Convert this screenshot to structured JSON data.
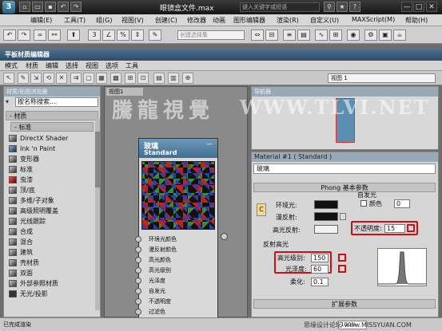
{
  "titlebar": {
    "doc_title": "眼镜盒文件.max",
    "search_placeholder": "键入关键字或短语",
    "min": "—",
    "max": "□",
    "close": "✕"
  },
  "menubar": [
    "编辑(E)",
    "工具(T)",
    "组(G)",
    "视图(V)",
    "创建(C)",
    "修改器",
    "动画",
    "图形编辑器",
    "渲染(R)",
    "自定义(U)",
    "MAXScript(M)",
    "帮助(H)"
  ],
  "maintoolbar": {
    "selection_set": "创建选择集",
    "numbers": [
      "3",
      "3",
      "%"
    ]
  },
  "sme": {
    "title": "平板材质编辑器",
    "menu": [
      "模式",
      "材质",
      "编辑",
      "选择",
      "视图",
      "选项",
      "工具"
    ],
    "view_select": "视图 1"
  },
  "browser": {
    "header": "材质/贴图浏览器",
    "search": "按名称搜索...",
    "category": "- 材质",
    "subcategory": "- 标准",
    "materials": [
      "DirectX Shader",
      "Ink 'n Paint",
      "变形器",
      "标准",
      "虫漆",
      "顶/底",
      "多维/子对象",
      "高级照明覆盖",
      "光线跟踪",
      "合成",
      "混合",
      "建筑",
      "壳材质",
      "双面",
      "外部参照材质",
      "无光/投影"
    ]
  },
  "view": {
    "tab": "视图1"
  },
  "node": {
    "name": "玻璃",
    "type": "Standard",
    "slots": [
      "环境光颜色",
      "漫反射颜色",
      "高光颜色",
      "高光级别",
      "光泽度",
      "自发光",
      "不透明度",
      "过滤色"
    ]
  },
  "navigator": {
    "header": "导航器"
  },
  "params": {
    "header": "Material #1 ( Standard )",
    "name": "玻璃",
    "rollout_basic": "Phong 基本参数",
    "ambient": "环境光:",
    "diffuse": "漫反射:",
    "specular": "高光反射:",
    "self_illum": "自发光",
    "color": "颜色",
    "color_value": "0",
    "opacity_label": "不透明度:",
    "opacity": "15",
    "spec_group": "反射高光",
    "spec_level_label": "高光级别:",
    "spec_level": "150",
    "gloss_label": "光泽度:",
    "gloss": "60",
    "soften_label": "柔化:",
    "soften": "0.1",
    "rollout_ext": "扩展参数",
    "ss_button": "C"
  },
  "status": {
    "text": "已完成渲染",
    "zoom": "100%"
  },
  "watermark": {
    "cn": "騰龍視覺",
    "en": "WWW.TLVI.NET",
    "site": "思缘设计论坛 www.MISSYUAN.COM"
  },
  "colors": {
    "title_bar": "#161616",
    "sme_title": "#2b4b6a",
    "highlight": "#d01010"
  }
}
